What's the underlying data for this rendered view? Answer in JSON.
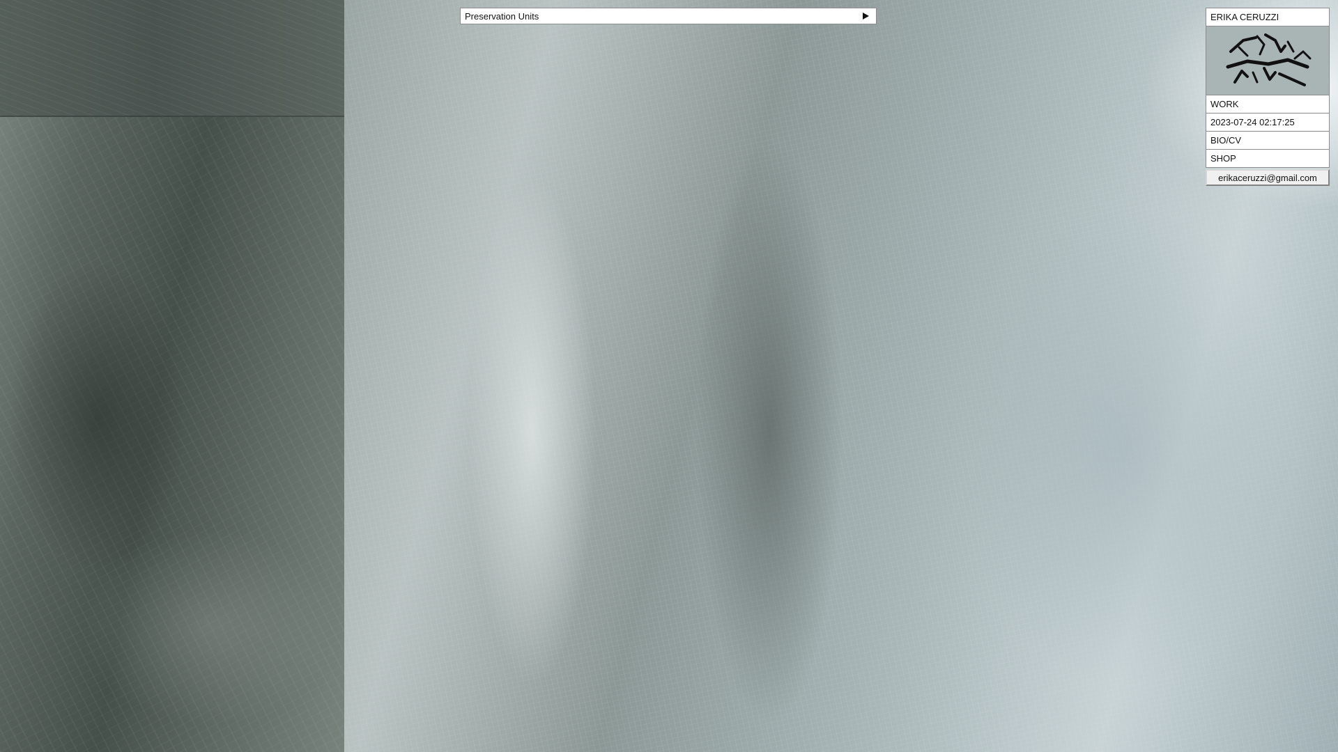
{
  "project": {
    "title": "Preservation Units",
    "play_icon": "play-icon"
  },
  "menu": {
    "name": "ERIKA CERUZZI",
    "logo_icon": "signature-logo-icon",
    "work_label": "WORK",
    "timestamp": "2023-07-24 02:17:25",
    "bio_label": "BIO/CV",
    "shop_label": "SHOP",
    "email": "erikaceruzzi@gmail.com"
  }
}
